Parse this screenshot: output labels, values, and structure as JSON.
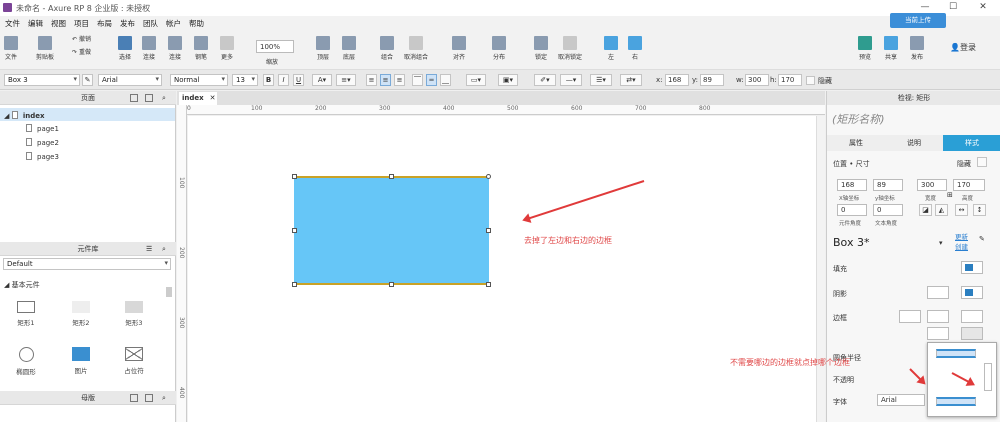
{
  "window": {
    "title": "未命名 - Axure RP 8 企业版 : 未授权"
  },
  "menu": [
    "文件",
    "编辑",
    "视图",
    "项目",
    "布局",
    "发布",
    "团队",
    "帐户",
    "帮助"
  ],
  "upload_button": "当前上传",
  "toolbar": {
    "file": "文件",
    "clipboard": "剪贴板",
    "undo": "撤销",
    "redo": "重做",
    "select": "选择",
    "connect": "连接",
    "pen": "钢笔",
    "more": "更多",
    "zoom_value": "100%",
    "zoom": "缩放",
    "top": "顶层",
    "bottom": "底层",
    "group": "组合",
    "ungroup": "取消组合",
    "align": "对齐",
    "distribute": "分布",
    "lock": "锁定",
    "unlock": "取消锁定",
    "left": "左",
    "right": "右",
    "preview": "预览",
    "share": "共享",
    "publish": "发布",
    "login": "登录"
  },
  "format": {
    "widget_name": "Box 3",
    "font": "Arial",
    "weight": "Normal",
    "size": "13",
    "bold": "B",
    "italic": "I",
    "underline": "U",
    "x_label": "x:",
    "x": "168",
    "y_label": "y:",
    "y": "89",
    "w_label": "w:",
    "w": "300",
    "h_label": "h:",
    "h": "170",
    "hidden": "隐藏"
  },
  "pages": {
    "title": "页面",
    "root": "index",
    "children": [
      "page1",
      "page2",
      "page3"
    ]
  },
  "library": {
    "title": "元件库",
    "selected": "Default",
    "section": "基本元件",
    "widgets": [
      "矩形1",
      "矩形2",
      "矩形3",
      "椭圆形",
      "图片",
      "占位符"
    ]
  },
  "masters": {
    "title": "母版"
  },
  "canvas": {
    "tab": "index",
    "ruler_top": [
      "0",
      "100",
      "200",
      "300",
      "400",
      "500",
      "600",
      "700",
      "800"
    ],
    "ruler_left": [
      "100",
      "200",
      "300",
      "400"
    ],
    "annotation_1": "去掉了左边和右边的边框",
    "annotation_2": "不需要哪边的边框就点掉哪个边框"
  },
  "inspector": {
    "title": "检视: 矩形",
    "shape_name": "(矩形名称)",
    "tabs": [
      "属性",
      "说明",
      "样式"
    ],
    "position_size": "位置 • 尺寸",
    "hidden": "隐藏",
    "x": "168",
    "y": "89",
    "w": "300",
    "h": "170",
    "x_label": "X轴坐标",
    "y_label": "y轴坐标",
    "w_label": "宽度",
    "h_label": "高度",
    "rot1": "0",
    "rot2": "0",
    "rot1_label": "元件角度",
    "rot2_label": "文本角度",
    "style_name": "Box 3*",
    "update": "更新",
    "create": "创建",
    "fill": "填充",
    "shadow": "阴影",
    "border": "边框",
    "corner_radius": "圆角半径",
    "opacity": "不透明",
    "font_label": "字体",
    "font_value": "Arial"
  },
  "colors": {
    "accent": "#2a9fd6",
    "box_fill": "#66c6f7",
    "box_border": "#c9a227",
    "annotation": "#e04848"
  }
}
